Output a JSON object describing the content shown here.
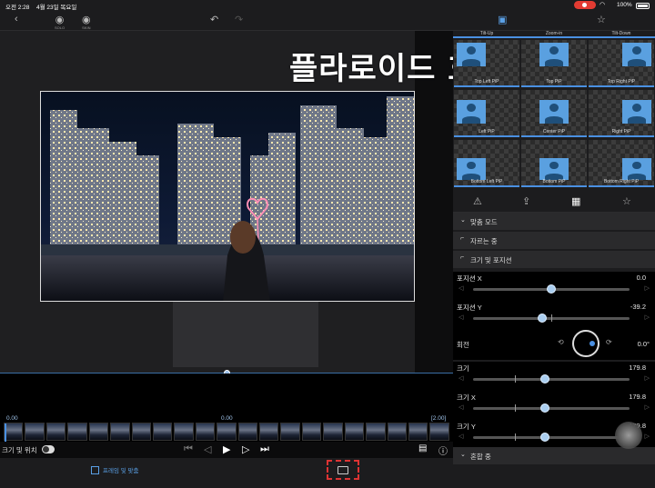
{
  "status": {
    "time": "오전 2:28",
    "date": "4월 23일 목요일",
    "battery": "100%"
  },
  "toolbar": {
    "icon_left_label": "SOLO",
    "icon_right_label": "SKIN"
  },
  "overlay": {
    "title": "플라로이드 효과"
  },
  "pip_presets": {
    "top_row": [
      "Tilt-Up",
      "Zoom-in",
      "Tilt-Down"
    ],
    "items": [
      "Top Left PiP",
      "Top PiP",
      "Top Right PiP",
      "Left PiP",
      "Center PiP",
      "Right PiP",
      "Bottom Left PiP",
      "Bottom PiP",
      "Bottom Right PiP"
    ]
  },
  "sections": {
    "fit_mode": "맞춤 모드",
    "cropping": "자르는 중",
    "size_position": "크기 및 포지션",
    "blending": "혼합 중"
  },
  "properties": {
    "position_x": {
      "label": "포지션 X",
      "value": "0.0",
      "level": 0.5
    },
    "position_y": {
      "label": "포지션 Y",
      "value": "-39.2",
      "level": 0.44
    },
    "rotation": {
      "label": "회전",
      "value": "0.0°"
    },
    "scale": {
      "label": "크기",
      "value": "179.8",
      "level": 0.46
    },
    "scale_x": {
      "label": "크기 X",
      "value": "179.8",
      "level": 0.46
    },
    "scale_y": {
      "label": "크기 Y",
      "value": "179.8",
      "level": 0.46
    }
  },
  "timeline": {
    "start": "0.00",
    "current": "0.00",
    "end": "[2.00]"
  },
  "controls": {
    "size_position_label": "크기 및 위치"
  },
  "bottom": {
    "frame_fit": "프레임 및 맞춤"
  }
}
